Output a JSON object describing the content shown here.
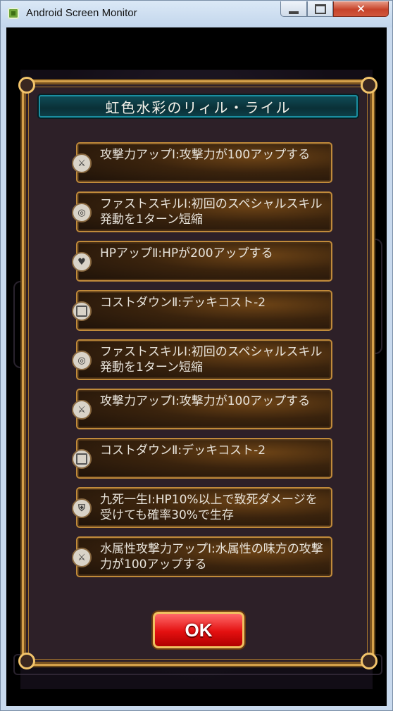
{
  "window": {
    "title": "Android Screen Monitor"
  },
  "dialog": {
    "title": "虹色水彩のリィル・ライル",
    "ok_label": "OK",
    "skills": [
      {
        "text": "攻撃力アップⅠ:攻撃力が100アップする",
        "icon": "sword-icon"
      },
      {
        "text": "ファストスキルⅠ:初回のスペシャルスキル発動を1ターン短縮",
        "icon": "clock-icon"
      },
      {
        "text": "HPアップⅡ:HPが200アップする",
        "icon": "heart-icon"
      },
      {
        "text": "コストダウンⅡ:デッキコスト-2",
        "icon": "card-icon"
      },
      {
        "text": "ファストスキルⅠ:初回のスペシャルスキル発動を1ターン短縮",
        "icon": "clock-icon"
      },
      {
        "text": "攻撃力アップⅠ:攻撃力が100アップする",
        "icon": "sword-icon"
      },
      {
        "text": "コストダウンⅡ:デッキコスト-2",
        "icon": "card-icon"
      },
      {
        "text": "九死一生Ⅰ:HP10%以上で致死ダメージを受けても確率30%で生存",
        "icon": "guard-icon"
      },
      {
        "text": "水属性攻撃力アップⅠ:水属性の味方の攻撃力が100アップする",
        "icon": "sword-icon"
      }
    ]
  },
  "colors": {
    "frame_gold": "#d4a04a",
    "header_teal": "#0f4b55",
    "ok_red": "#e41010"
  }
}
